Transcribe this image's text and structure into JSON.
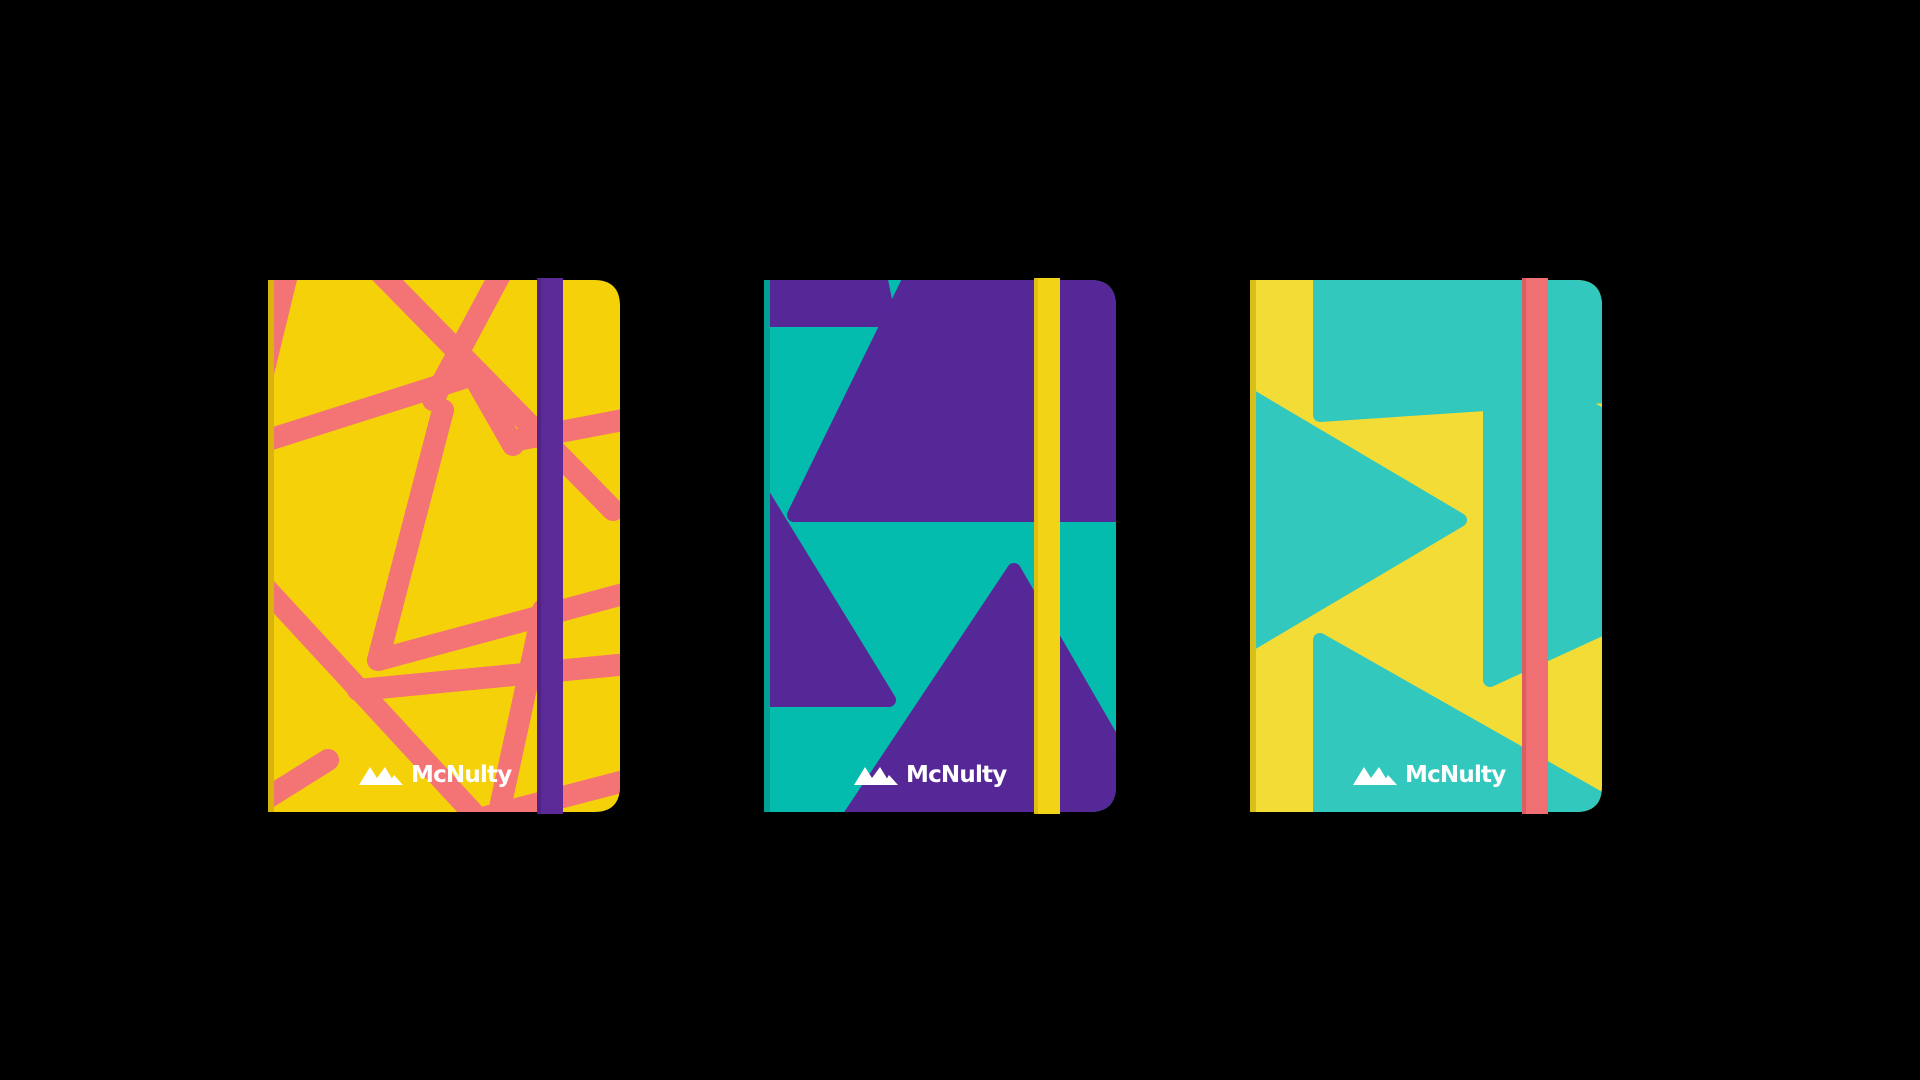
{
  "brand": {
    "name": "McNulty",
    "logo_icon": "mountain-peaks-icon",
    "logo_color": "#ffffff"
  },
  "background_color": "#000000",
  "notebooks": [
    {
      "cover_color": "#f5d10a",
      "pattern_color": "#f47475",
      "band_color": "#5b2a96",
      "pattern": "triangle-outline-grid"
    },
    {
      "cover_color": "#04bcae",
      "pattern_color": "#552797",
      "band_color": "#f3d316",
      "pattern": "large-triangles"
    },
    {
      "cover_color": "#f4dc37",
      "pattern_color": "#33c8bd",
      "band_color": "#f06f72",
      "pattern": "play-triangles"
    }
  ]
}
